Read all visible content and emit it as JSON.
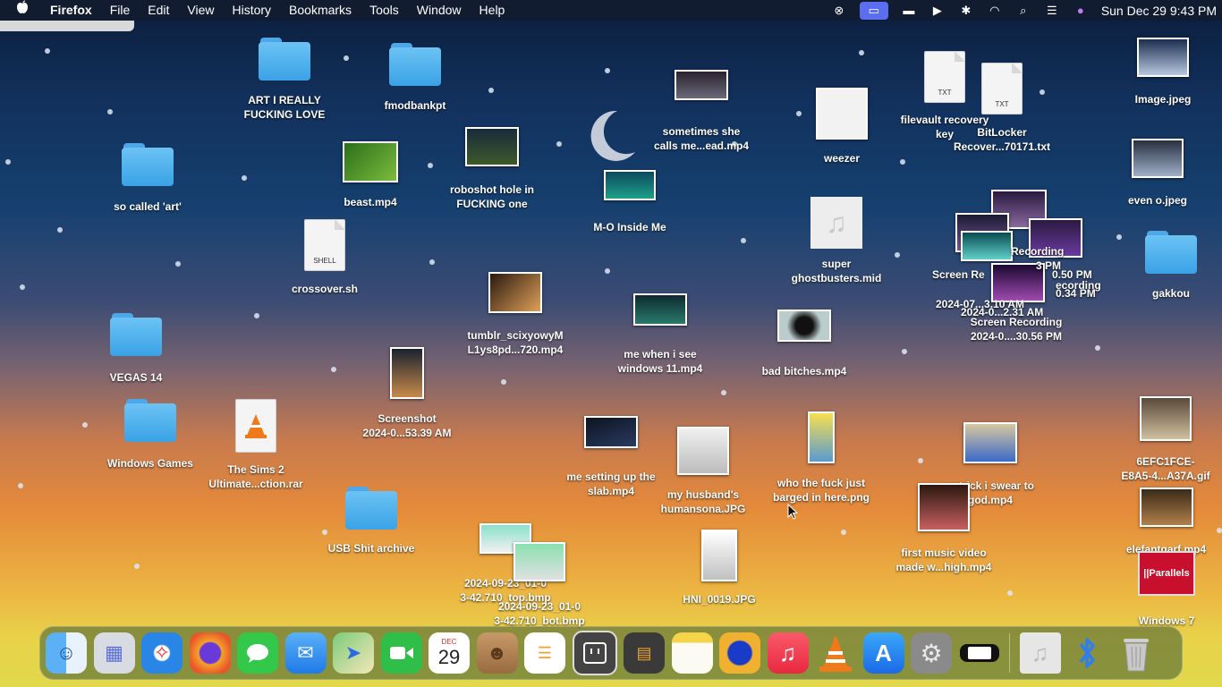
{
  "menubar": {
    "app_name": "Firefox",
    "menus": [
      "File",
      "Edit",
      "View",
      "History",
      "Bookmarks",
      "Tools",
      "Window",
      "Help"
    ],
    "clock": "Sun Dec 29  9:43 PM",
    "status_icons": [
      "binoculars-icon",
      "screen-mirroring-icon",
      "battery-icon",
      "play-icon",
      "bluetooth-icon",
      "wifi-icon",
      "search-icon",
      "control-center-icon",
      "siri-icon"
    ]
  },
  "desktop": {
    "icons": [
      {
        "label": "ART I REALLY\nFUCKING LOVE",
        "kind": "folder"
      },
      {
        "label": "fmodbankpt",
        "kind": "folder"
      },
      {
        "label": "so called 'art'",
        "kind": "folder"
      },
      {
        "label": "beast.mp4",
        "kind": "video"
      },
      {
        "label": "roboshot hole in\nFUCKING one",
        "kind": "video"
      },
      {
        "label": "sometimes she\ncalls me...ead.mp4",
        "kind": "video"
      },
      {
        "label": "M-O Inside Me",
        "kind": "image"
      },
      {
        "label": "weezer",
        "kind": "image"
      },
      {
        "label": "filevault recovery\nkey",
        "kind": "txt"
      },
      {
        "label": "BitLocker\nRecover...70171.txt",
        "kind": "txt"
      },
      {
        "label": "Image.jpeg",
        "kind": "image"
      },
      {
        "label": "even o.jpeg",
        "kind": "image"
      },
      {
        "label": "crossover.sh",
        "kind": "shell"
      },
      {
        "label": "super\nghostbusters.mid",
        "kind": "music"
      },
      {
        "label": "gakkou",
        "kind": "folder"
      },
      {
        "label": "tumblr_scixyowyM\nL1ys8pd...720.mp4",
        "kind": "video"
      },
      {
        "label": "me when i see\nwindows 11.mp4",
        "kind": "video"
      },
      {
        "label": "bad bitches.mp4",
        "kind": "video"
      },
      {
        "label": "VEGAS 14",
        "kind": "folder"
      },
      {
        "label": "Screenshot\n2024-0...53.39 AM",
        "kind": "image"
      },
      {
        "label": "Windows Games",
        "kind": "folder"
      },
      {
        "label": "The Sims 2\nUltimate...ction.rar",
        "kind": "vlc"
      },
      {
        "label": "me setting up the\nslab.mp4",
        "kind": "video"
      },
      {
        "label": "my husband's\nhumansona.JPG",
        "kind": "image"
      },
      {
        "label": "who the fuck just\nbarged in here.png",
        "kind": "image"
      },
      {
        "label": "patrick i swear to\ngod.mp4",
        "kind": "video"
      },
      {
        "label": "6EFC1FCE-\nE8A5-4...A37A.gif",
        "kind": "image"
      },
      {
        "label": "USB Shit archive",
        "kind": "folder"
      },
      {
        "label": "first music video\nmade w...high.mp4",
        "kind": "video"
      },
      {
        "label": "elefantgarf.mp4",
        "kind": "video"
      },
      {
        "label": "2024-09-23_01-0\n3-42.710_top.bmp",
        "kind": "image"
      },
      {
        "label": "2024-09-23_01-0\n3-42.710_bot.bmp",
        "kind": "image"
      },
      {
        "label": "HNI_0019.JPG",
        "kind": "image"
      },
      {
        "label": "Windows 7",
        "kind": "parallels"
      },
      {
        "label": "Screen Recording\n2024-0....30.56 PM",
        "kind": "video"
      }
    ],
    "pile_labels": [
      "Recording",
      "Screen Re",
      "2024-07...3.10 AM",
      "3 PM",
      "0.50 PM",
      "ecording",
      "0.34 PM",
      "2024-0...2.31 AM"
    ]
  },
  "dock": {
    "apps": [
      {
        "name": "finder-icon",
        "glyph": "☺",
        "color": "#2e8fe8"
      },
      {
        "name": "launchpad-icon",
        "glyph": "▦",
        "color": "#8a8fa0"
      },
      {
        "name": "safari-icon",
        "glyph": "✧",
        "color": "#2a86e6"
      },
      {
        "name": "firefox-icon",
        "glyph": "●",
        "color": "#e8572a"
      },
      {
        "name": "messages-icon",
        "glyph": "💬",
        "color": "#34c84a"
      },
      {
        "name": "mail-icon",
        "glyph": "✉",
        "color": "#2f8ef0"
      },
      {
        "name": "maps-icon",
        "glyph": "➤",
        "color": "#5fb870"
      },
      {
        "name": "facetime-icon",
        "glyph": "▶",
        "color": "#2fbf48"
      },
      {
        "name": "calendar-icon",
        "glyph": "29",
        "color": "#ffffff",
        "month": "DEC"
      },
      {
        "name": "contacts-icon",
        "glyph": "☻",
        "color": "#b0855a"
      },
      {
        "name": "reminders-icon",
        "glyph": "☰",
        "color": "#ffffff"
      },
      {
        "name": "crossover-icon",
        "glyph": "▣",
        "color": "#3a3a3a"
      },
      {
        "name": "calculator-icon",
        "glyph": "▤",
        "color": "#555555"
      },
      {
        "name": "notes-icon",
        "glyph": "▭",
        "color": "#f6d44a"
      },
      {
        "name": "audacity-icon",
        "glyph": "🎧",
        "color": "#f0b030"
      },
      {
        "name": "music-icon",
        "glyph": "♫",
        "color": "#f2394f"
      },
      {
        "name": "vlc-icon",
        "glyph": "▲",
        "color": "#f07a1a"
      },
      {
        "name": "app-store-icon",
        "glyph": "A",
        "color": "#1e7cf0"
      },
      {
        "name": "system-settings-icon",
        "glyph": "⚙",
        "color": "#8a8a8a"
      },
      {
        "name": "switch-icon",
        "glyph": "▬",
        "color": "#222222"
      }
    ],
    "extras": [
      {
        "name": "music-file-stack-icon",
        "glyph": "♫",
        "color": "#d9d9d9"
      },
      {
        "name": "bluetooth-file-exchange-icon",
        "glyph": "✱",
        "color": "#2f7ef0"
      },
      {
        "name": "trash-icon",
        "glyph": "🗑",
        "color": "#c9c9c9"
      }
    ]
  }
}
